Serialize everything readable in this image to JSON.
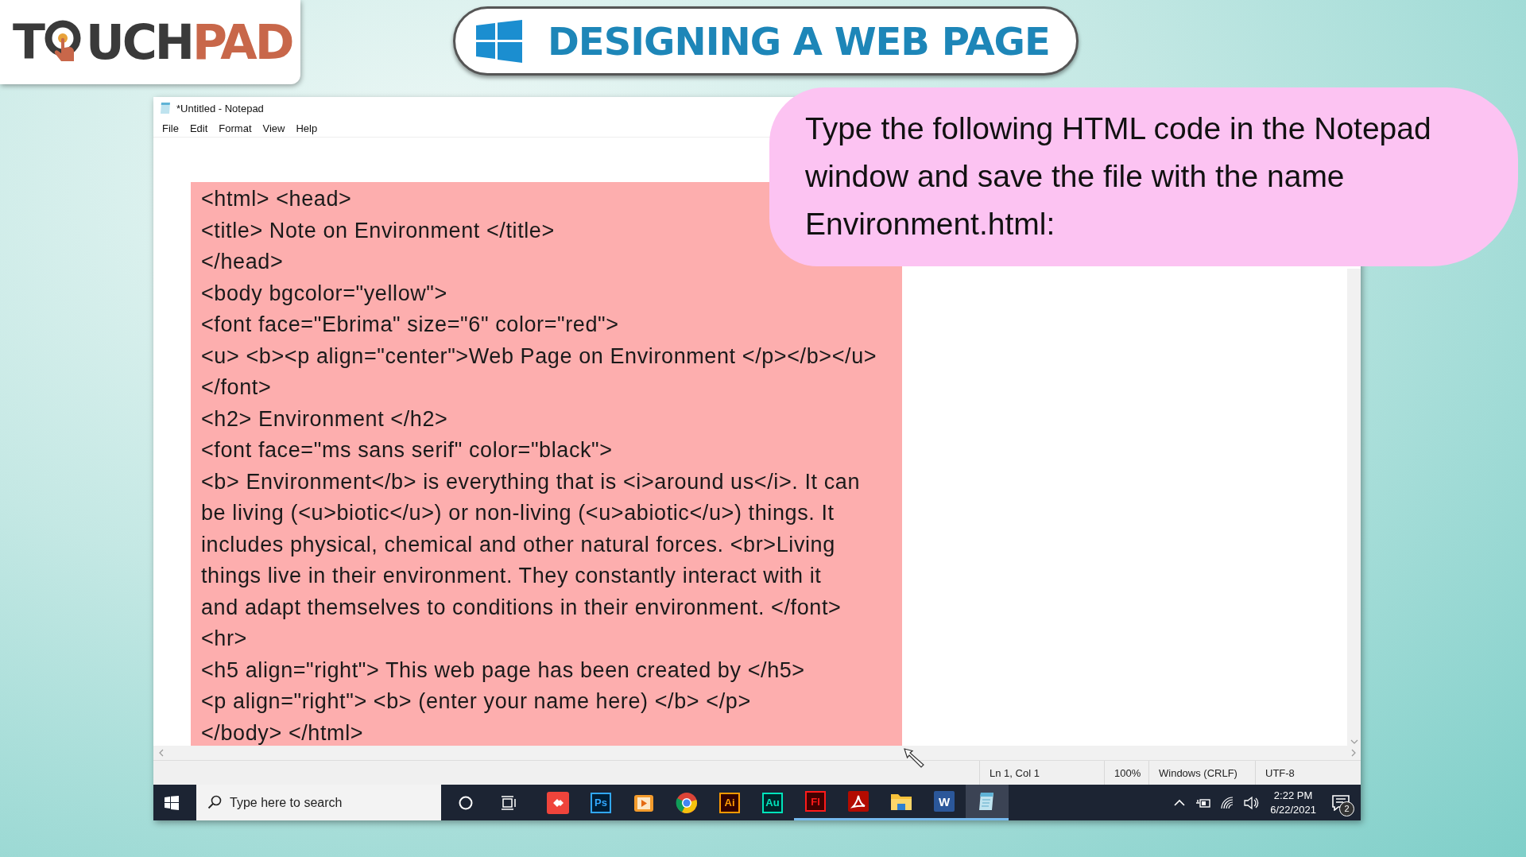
{
  "logo": {
    "before": "T",
    "after": "UCH",
    "accent": "PAD"
  },
  "banner": {
    "title": "DESIGNING A WEB PAGE"
  },
  "notepad": {
    "title": "*Untitled - Notepad",
    "menu": [
      "File",
      "Edit",
      "Format",
      "View",
      "Help"
    ],
    "lines": [
      "<html> <head>",
      "<title> Note on Environment </title>",
      "</head>",
      "<body bgcolor=\"yellow\">",
      "<font face=\"Ebrima\" size=\"6\" color=\"red\">",
      "<u> <b><p align=\"center\">Web Page on Environment </p></b></u>",
      "</font>",
      "<h2> Environment </h2>",
      "<font face=\"ms sans serif\" color=\"black\">",
      "<b> Environment</b> is everything that is <i>around us</i>. It can",
      "be living (<u>biotic</u>) or non-living (<u>abiotic</u>) things. It",
      "includes physical, chemical and other natural forces. <br>Living",
      "things live in their environment. They constantly interact with it",
      "and adapt themselves to conditions in their environment. </font>",
      "<hr>",
      "<h5 align=\"right\"> This web page has been created by </h5>",
      "<p align=\"right\"> <b> (enter your name here) </b> </p>",
      "</body> </html>"
    ],
    "status": [
      "Ln 1, Col 1",
      "100%",
      "Windows (CRLF)",
      "UTF-8"
    ]
  },
  "taskbar": {
    "search": {
      "placeholder": "Type here to search"
    },
    "apps": [
      {
        "kind": "remote",
        "running": false,
        "selected": false
      },
      {
        "kind": "letters",
        "label": "Ps",
        "running": false,
        "selected": false
      },
      {
        "kind": "player",
        "running": false,
        "selected": false
      },
      {
        "kind": "browser",
        "running": false,
        "selected": false
      },
      {
        "kind": "letters",
        "label": "Ai",
        "running": false,
        "selected": false
      },
      {
        "kind": "letters",
        "label": "Au",
        "running": false,
        "selected": false
      },
      {
        "kind": "letters",
        "label": "Fl",
        "running": true,
        "selected": false
      },
      {
        "kind": "pdf",
        "running": true,
        "selected": false
      },
      {
        "kind": "folder",
        "running": true,
        "selected": false
      },
      {
        "kind": "letters",
        "label": "W",
        "running": true,
        "selected": false
      },
      {
        "kind": "notepad",
        "running": true,
        "selected": true
      }
    ],
    "time": "2:22 PM",
    "date": "6/22/2021",
    "notifications": "2"
  },
  "callout": {
    "text": "Type the following HTML code in the Notepad window and save the file with the name Environment.html:"
  }
}
